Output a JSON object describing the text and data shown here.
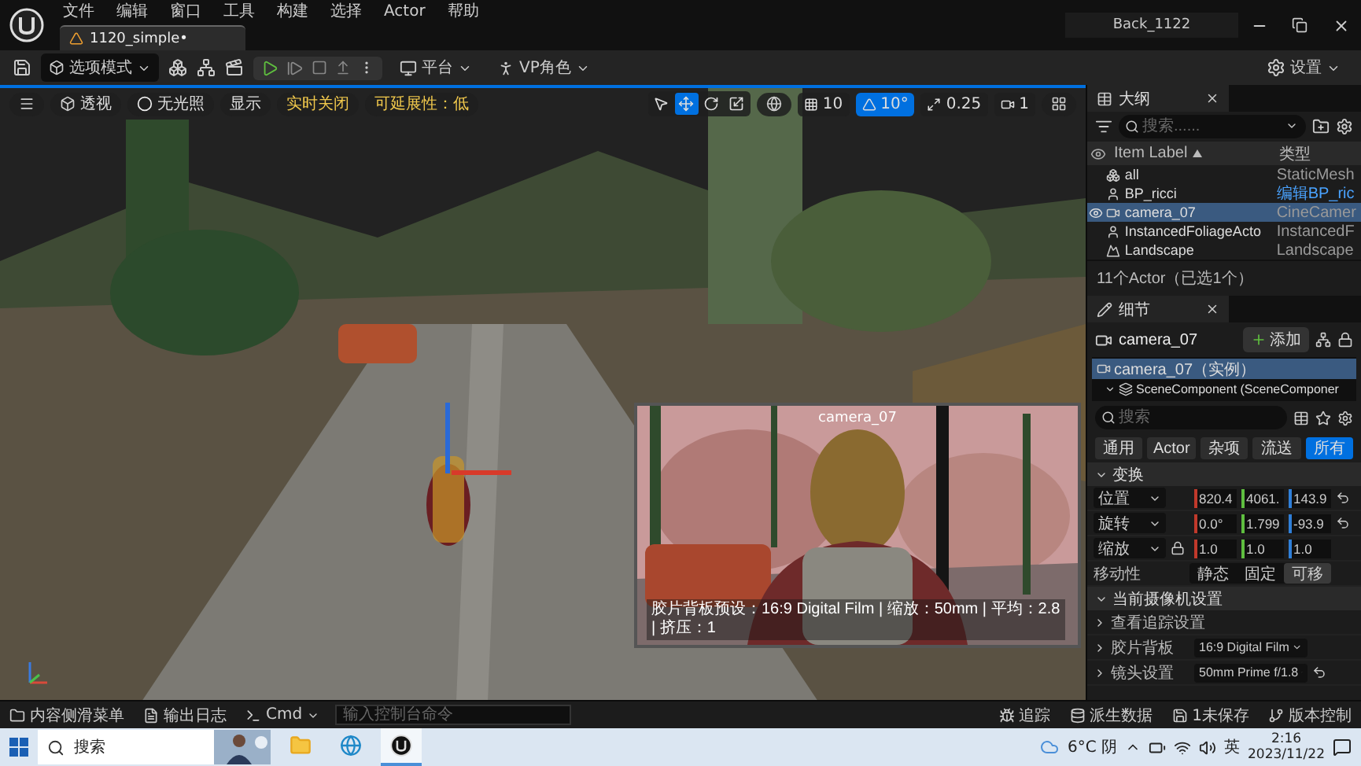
{
  "menu": [
    "文件",
    "编辑",
    "窗口",
    "工具",
    "构建",
    "选择",
    "Actor",
    "帮助"
  ],
  "document_tab": {
    "label": "1120_simple•",
    "selected": true
  },
  "project": "Back_1122",
  "toolbar": {
    "mode": "选项模式",
    "platform": "平台",
    "vp": "VP角色",
    "settings": "设置"
  },
  "viewport_bar": {
    "perspective": "透视",
    "lighting": "无光照",
    "show": "显示",
    "realtime": "实时关闭",
    "scalability": "可延展性：低",
    "tools": [
      {
        "kind": "select",
        "selected": false
      },
      {
        "kind": "move",
        "selected": true
      },
      {
        "kind": "rotate",
        "selected": false
      },
      {
        "kind": "scale",
        "selected": false
      }
    ],
    "snaps": [
      {
        "kind": "grid",
        "label": "10",
        "on": false
      },
      {
        "kind": "angle",
        "label": "10°",
        "on": true
      },
      {
        "kind": "scale",
        "label": "0.25",
        "on": false
      }
    ],
    "camera_speed": "1"
  },
  "preview": {
    "title": "camera_07",
    "caption": "胶片背板预设：16:9 Digital Film | 缩放：50mm | 平均：2.8 | 挤压：1"
  },
  "outliner": {
    "title": "大纲",
    "search_placeholder": "搜索......",
    "columns": [
      {
        "label": "Item Label",
        "sort_ascending": true
      },
      {
        "label": "类型"
      }
    ],
    "rows": [
      {
        "kind": "mesh",
        "label": "all",
        "type": "StaticMesh",
        "type_link": false,
        "selected": false,
        "visible": false
      },
      {
        "kind": "actor",
        "label": "BP_ricci",
        "type": "编辑BP_ric",
        "type_link": true,
        "selected": false,
        "visible": false
      },
      {
        "kind": "camera",
        "label": "camera_07",
        "type": "CineCamer",
        "type_link": false,
        "selected": true,
        "visible": true
      },
      {
        "kind": "actor",
        "label": "InstancedFoliageActo",
        "type": "InstancedF",
        "type_link": false,
        "selected": false,
        "visible": false
      },
      {
        "kind": "landscape",
        "label": "Landscape",
        "type": "Landscape",
        "type_link": false,
        "selected": false,
        "visible": false
      }
    ],
    "footer": "11个Actor（已选1个）"
  },
  "details": {
    "title": "细节",
    "actor": "camera_07",
    "add": "添加",
    "components": [
      {
        "label": "camera_07（实例）",
        "selected": true,
        "children": [
          {
            "label": "SceneComponent (SceneComponer",
            "selected": false
          }
        ]
      }
    ],
    "search_placeholder": "搜索",
    "filters": [
      {
        "label": "通用",
        "selected": false
      },
      {
        "label": "Actor",
        "selected": false
      },
      {
        "label": "杂项",
        "selected": false
      },
      {
        "label": "流送",
        "selected": false
      },
      {
        "label": "所有",
        "selected": true
      }
    ],
    "sections": [
      {
        "title": "变换",
        "expanded": true,
        "rows": [
          {
            "kind": "vector",
            "label": "位置",
            "values": [
              "820.4",
              "4061.",
              "143.9"
            ],
            "reset": true,
            "lock": false
          },
          {
            "kind": "vector",
            "label": "旋转",
            "values": [
              "0.0°",
              "1.799",
              "-93.9"
            ],
            "reset": true,
            "lock": false
          },
          {
            "kind": "vector",
            "label": "缩放",
            "values": [
              "1.0",
              "1.0",
              "1.0"
            ],
            "reset": false,
            "lock": true
          },
          {
            "kind": "mobility",
            "label": "移动性",
            "options": [
              {
                "label": "静态",
                "selected": false
              },
              {
                "label": "固定",
                "selected": false
              },
              {
                "label": "可移",
                "selected": true
              }
            ]
          }
        ]
      },
      {
        "title": "当前摄像机设置",
        "expanded": true,
        "rows": [
          {
            "kind": "group",
            "label": "查看追踪设置"
          },
          {
            "kind": "dropdown",
            "label": "胶片背板",
            "value": "16:9 Digital Film",
            "reset": false
          },
          {
            "kind": "dropdown",
            "label": "镜头设置",
            "value": "50mm Prime f/1.8",
            "reset": true
          }
        ]
      }
    ]
  },
  "status_bar": {
    "left": [
      {
        "kind": "content",
        "label": "内容侧滑菜单"
      },
      {
        "kind": "log",
        "label": "输出日志"
      }
    ],
    "cmd": "Cmd",
    "console_placeholder": "输入控制台命令",
    "right": [
      {
        "kind": "trace",
        "label": "追踪"
      },
      {
        "kind": "ddc",
        "label": "派生数据"
      },
      {
        "kind": "save",
        "label": "1未保存"
      },
      {
        "kind": "vcs",
        "label": "版本控制"
      }
    ]
  },
  "taskbar": {
    "search": "搜索",
    "apps": [
      {
        "kind": "explorer",
        "active": false
      },
      {
        "kind": "edge",
        "active": false
      },
      {
        "kind": "unreal",
        "active": true
      }
    ],
    "weather": "6°C 阴",
    "language": "英",
    "time": "2:16",
    "date": "2023/11/22"
  }
}
